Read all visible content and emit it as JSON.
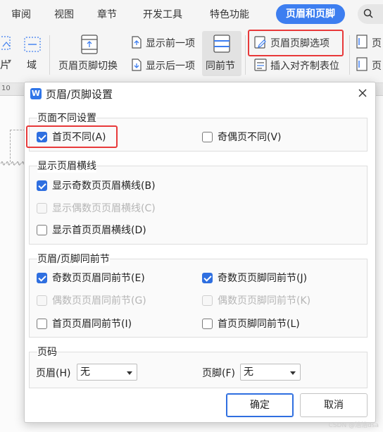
{
  "ribbon": {
    "tabs": [
      {
        "label": "审阅"
      },
      {
        "label": "视图"
      },
      {
        "label": "章节"
      },
      {
        "label": "开发工具"
      },
      {
        "label": "特色功能"
      }
    ],
    "active_tab": "页眉和页脚",
    "search_more": "₹"
  },
  "toolbar": {
    "left_partial_1": "片",
    "left_partial_2": "域",
    "switch_header_footer": "页眉页脚切换",
    "show_previous": "显示前一项",
    "show_next": "显示后一项",
    "same_as_previous": "同前节",
    "header_footer_options": "页眉页脚选项",
    "insert_align_tab": "插入对齐制表位",
    "right_partial_1": "页",
    "right_partial_2": "页"
  },
  "ruler": {
    "mark": "10"
  },
  "dialog": {
    "title": "页眉/页脚设置",
    "group_different": {
      "title": "页面不同设置",
      "first_page_different": {
        "label": "首页不同(A)",
        "checked": true
      },
      "odd_even_different": {
        "label": "奇偶页不同(V)",
        "checked": false
      }
    },
    "group_header_line": {
      "title": "显示页眉横线",
      "show_odd_line": {
        "label": "显示奇数页页眉横线(B)",
        "checked": true
      },
      "show_even_line": {
        "label": "显示偶数页页眉横线(C)",
        "checked": false,
        "disabled": true
      },
      "show_first_line": {
        "label": "显示首页页眉横线(D)",
        "checked": false
      }
    },
    "group_same_prev": {
      "title": "页眉/页脚同前节",
      "odd_header_same": {
        "label": "奇数页页眉同前节(E)",
        "checked": true
      },
      "odd_footer_same": {
        "label": "奇数页页脚同前节(J)",
        "checked": true
      },
      "even_header_same": {
        "label": "偶数页页眉同前节(G)",
        "checked": false,
        "disabled": true
      },
      "even_footer_same": {
        "label": "偶数页页脚同前节(K)",
        "checked": false,
        "disabled": true
      },
      "first_header_same": {
        "label": "首页页眉同前节(I)",
        "checked": false
      },
      "first_footer_same": {
        "label": "首页页脚同前节(L)",
        "checked": false
      }
    },
    "group_page_number": {
      "title": "页码",
      "header_label": "页眉(H)",
      "header_value": "无",
      "footer_label": "页脚(F)",
      "footer_value": "无"
    },
    "ok_button": "确定",
    "cancel_button": "取消"
  },
  "watermark": "CSDN @浩浩dsa",
  "colors": {
    "accent": "#3d7ef0",
    "checkbox_checked": "#2f6fe0",
    "highlight_red": "#e8393a"
  }
}
